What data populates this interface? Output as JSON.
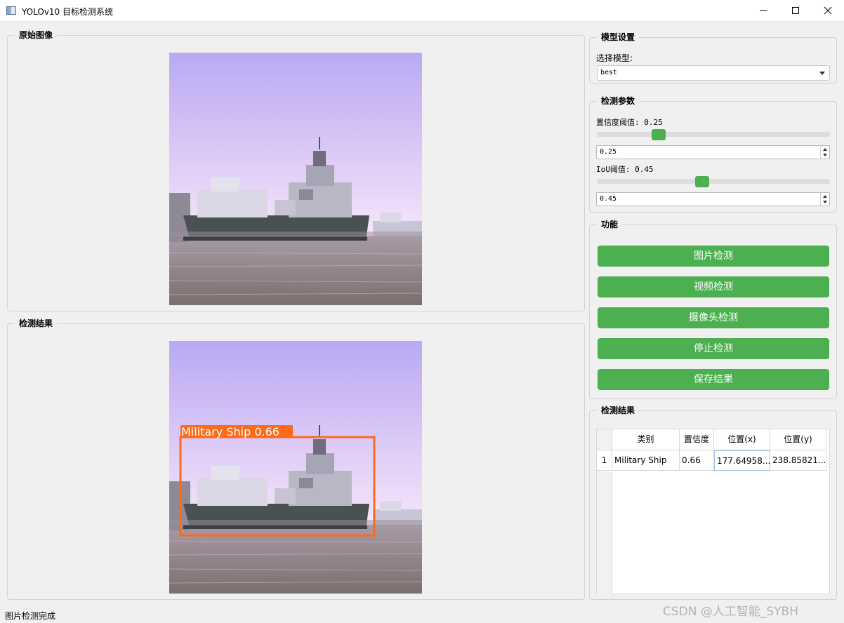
{
  "window": {
    "title": "YOLOv10 目标检测系统"
  },
  "original_panel": {
    "title": "原始图像"
  },
  "result_panel": {
    "title": "检测结果",
    "detection_label": "Military Ship 0.66",
    "box_color": "#ff6a1a"
  },
  "model_settings": {
    "title": "模型设置",
    "select_label": "选择模型:",
    "selected_model": "best"
  },
  "detect_params": {
    "title": "检测参数",
    "confidence_label": "置信度阈值: 0.25",
    "confidence_value": "0.25",
    "confidence_level": 0.25,
    "iou_label": "IoU阈值: 0.45",
    "iou_value": "0.45",
    "iou_level": 0.45
  },
  "functions": {
    "title": "功能",
    "buttons": [
      "图片检测",
      "视频检测",
      "摄像头检测",
      "停止检测",
      "保存结果"
    ],
    "button_color": "#4caf50"
  },
  "results_table": {
    "title": "检测结果",
    "headers": [
      "类别",
      "置信度",
      "位置(x)",
      "位置(y)"
    ],
    "rows": [
      {
        "index": "1",
        "cells": [
          "Military Ship",
          "0.66",
          "177.64958...",
          "238.85821..."
        ]
      }
    ]
  },
  "status_bar": {
    "text": "图片检测完成"
  },
  "watermark": {
    "text": "CSDN @人工智能_SYBH"
  }
}
